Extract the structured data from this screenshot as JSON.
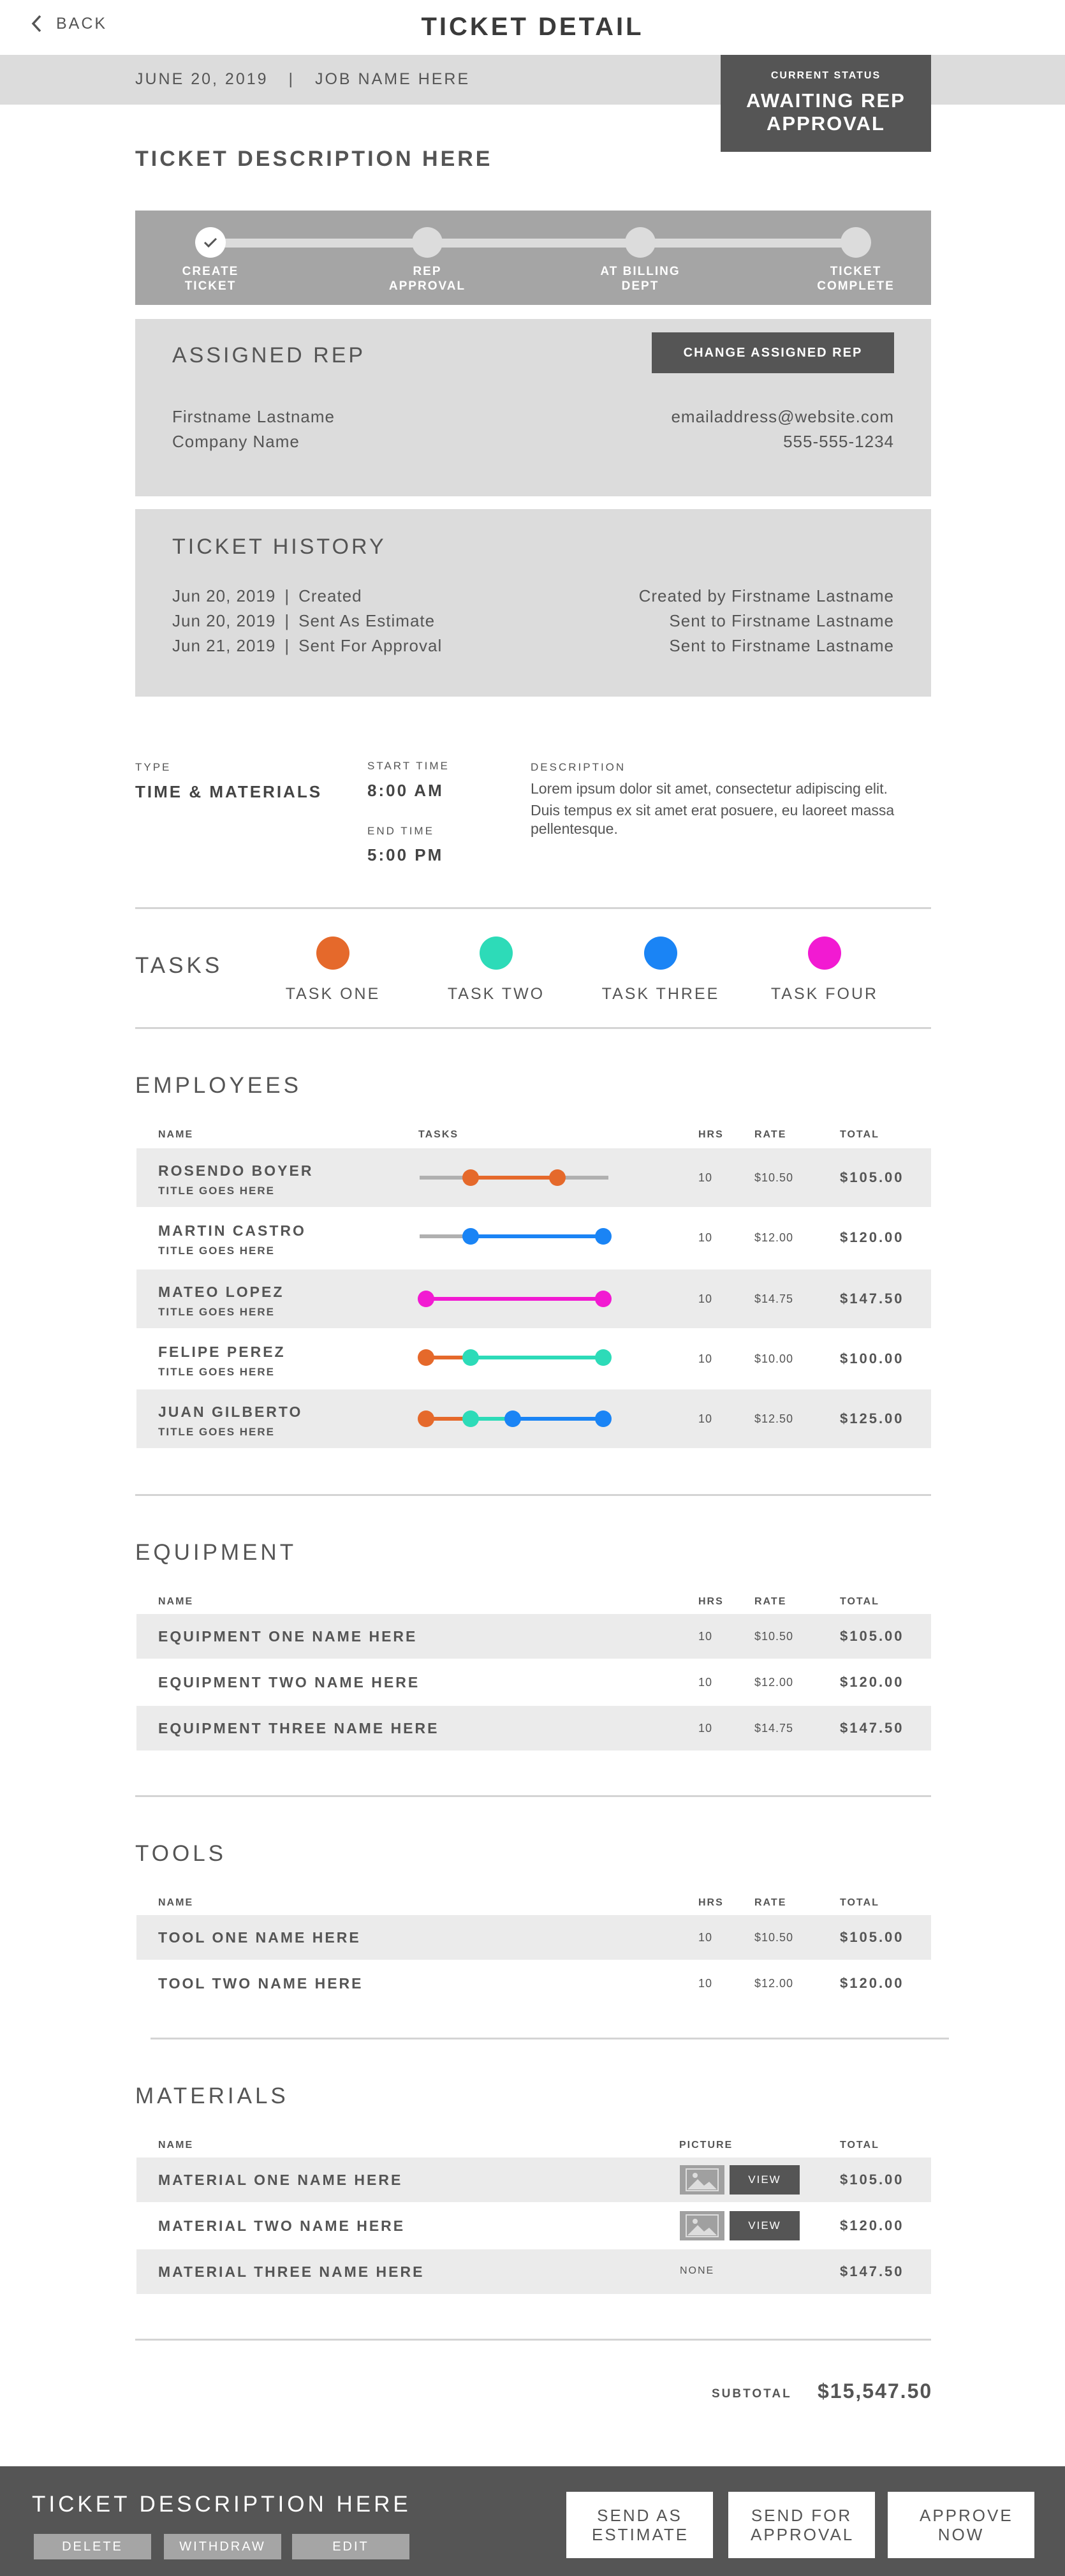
{
  "header": {
    "back_label": "BACK",
    "title": "TICKET DETAIL",
    "date": "JUNE 20, 2019",
    "separator": "|",
    "job_name": "JOB NAME HERE",
    "status_label": "CURRENT STATUS",
    "status_value": "AWAITING REP APPROVAL"
  },
  "ticket": {
    "description_title": "TICKET DESCRIPTION HERE"
  },
  "progress": {
    "steps": [
      {
        "label": "CREATE TICKET",
        "done": true
      },
      {
        "label": "REP APPROVAL",
        "done": false
      },
      {
        "label": "AT BILLING DEPT",
        "done": false
      },
      {
        "label": "TICKET COMPLETE",
        "done": false
      }
    ]
  },
  "assigned_rep": {
    "title": "ASSIGNED REP",
    "button_label": "CHANGE ASSIGNED REP",
    "name": "Firstname Lastname",
    "company": "Company Name",
    "email": "emailaddress@website.com",
    "phone": "555-555-1234"
  },
  "history": {
    "title": "TICKET HISTORY",
    "entries": [
      {
        "date": "Jun 20, 2019",
        "action": "Created",
        "detail": "Created by Firstname Lastname"
      },
      {
        "date": "Jun 20, 2019",
        "action": "Sent As Estimate",
        "detail": "Sent to Firstname Lastname"
      },
      {
        "date": "Jun 21, 2019",
        "action": "Sent For Approval",
        "detail": "Sent to Firstname Lastname"
      }
    ]
  },
  "details": {
    "type_label": "TYPE",
    "type_value": "TIME & MATERIALS",
    "start_label": "START TIME",
    "start_value": "8:00 AM",
    "end_label": "END TIME",
    "end_value": "5:00 PM",
    "description_label": "DESCRIPTION",
    "description_line1": "Lorem ipsum dolor sit amet, consectetur adipiscing elit.",
    "description_line2": "Duis tempus ex sit amet erat posuere, eu laoreet massa pellentesque."
  },
  "tasks": {
    "title": "TASKS",
    "items": [
      {
        "label": "TASK ONE",
        "color": "#e5692b"
      },
      {
        "label": "TASK TWO",
        "color": "#2ddbb8"
      },
      {
        "label": "TASK THREE",
        "color": "#1a84f5"
      },
      {
        "label": "TASK FOUR",
        "color": "#f21ad2"
      }
    ]
  },
  "employees": {
    "title": "EMPLOYEES",
    "columns": {
      "name": "NAME",
      "tasks": "TASKS",
      "hrs": "HRS",
      "rate": "RATE",
      "total": "TOTAL"
    },
    "rows": [
      {
        "name": "ROSENDO BOYER",
        "title": "TITLE GOES HERE",
        "hrs": "10",
        "rate": "$10.50",
        "total": "$105.00"
      },
      {
        "name": "MARTIN CASTRO",
        "title": "TITLE GOES HERE",
        "hrs": "10",
        "rate": "$12.00",
        "total": "$120.00"
      },
      {
        "name": "MATEO LOPEZ",
        "title": "TITLE GOES HERE",
        "hrs": "10",
        "rate": "$14.75",
        "total": "$147.50"
      },
      {
        "name": "FELIPE PEREZ",
        "title": "TITLE GOES HERE",
        "hrs": "10",
        "rate": "$10.00",
        "total": "$100.00"
      },
      {
        "name": "JUAN GILBERTO",
        "title": "TITLE GOES HERE",
        "hrs": "10",
        "rate": "$12.50",
        "total": "$125.00"
      }
    ]
  },
  "equipment": {
    "title": "EQUIPMENT",
    "columns": {
      "name": "NAME",
      "hrs": "HRS",
      "rate": "RATE",
      "total": "TOTAL"
    },
    "rows": [
      {
        "name": "EQUIPMENT ONE NAME HERE",
        "hrs": "10",
        "rate": "$10.50",
        "total": "$105.00"
      },
      {
        "name": "EQUIPMENT TWO NAME HERE",
        "hrs": "10",
        "rate": "$12.00",
        "total": "$120.00"
      },
      {
        "name": "EQUIPMENT THREE NAME HERE",
        "hrs": "10",
        "rate": "$14.75",
        "total": "$147.50"
      }
    ]
  },
  "tools": {
    "title": "TOOLS",
    "columns": {
      "name": "NAME",
      "hrs": "HRS",
      "rate": "RATE",
      "total": "TOTAL"
    },
    "rows": [
      {
        "name": "TOOL ONE NAME HERE",
        "hrs": "10",
        "rate": "$10.50",
        "total": "$105.00"
      },
      {
        "name": "TOOL TWO NAME HERE",
        "hrs": "10",
        "rate": "$12.00",
        "total": "$120.00"
      }
    ]
  },
  "materials": {
    "title": "MATERIALS",
    "columns": {
      "name": "NAME",
      "picture": "PICTURE",
      "total": "TOTAL"
    },
    "view_label": "VIEW",
    "rows": [
      {
        "name": "MATERIAL ONE NAME HERE",
        "picture": "image",
        "total": "$105.00"
      },
      {
        "name": "MATERIAL TWO NAME HERE",
        "picture": "image",
        "total": "$120.00"
      },
      {
        "name": "MATERIAL THREE NAME HERE",
        "picture": "NONE",
        "total": "$147.50"
      }
    ]
  },
  "subtotal": {
    "label": "SUBTOTAL",
    "value": "$15,547.50"
  },
  "footer": {
    "title": "TICKET DESCRIPTION HERE",
    "delete_label": "DELETE",
    "withdraw_label": "WITHDRAW",
    "edit_label": "EDIT",
    "send_estimate_label": "SEND AS ESTIMATE",
    "send_approval_label": "SEND FOR APPROVAL",
    "approve_label": "APPROVE NOW"
  }
}
